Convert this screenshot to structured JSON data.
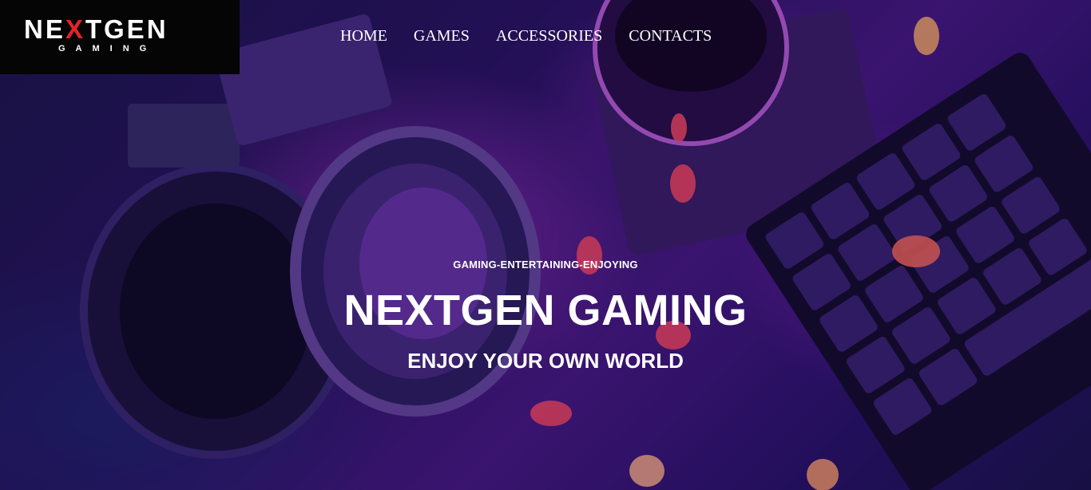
{
  "logo": {
    "main_pre": "NE",
    "main_x": "X",
    "main_post": "TGEN",
    "sub": "GAMING"
  },
  "nav": {
    "items": [
      {
        "label": "HOME"
      },
      {
        "label": "GAMES"
      },
      {
        "label": "ACCESSORIES"
      },
      {
        "label": "CONTACTS"
      }
    ]
  },
  "hero": {
    "tagline": "GAMING-ENTERTAINING-ENJOYING",
    "title": "NEXTGEN GAMING",
    "subtitle": "ENJOY YOUR OWN WORLD"
  },
  "colors": {
    "accent": "#e3232a",
    "logo_bg": "#050505",
    "text": "#ffffff"
  }
}
